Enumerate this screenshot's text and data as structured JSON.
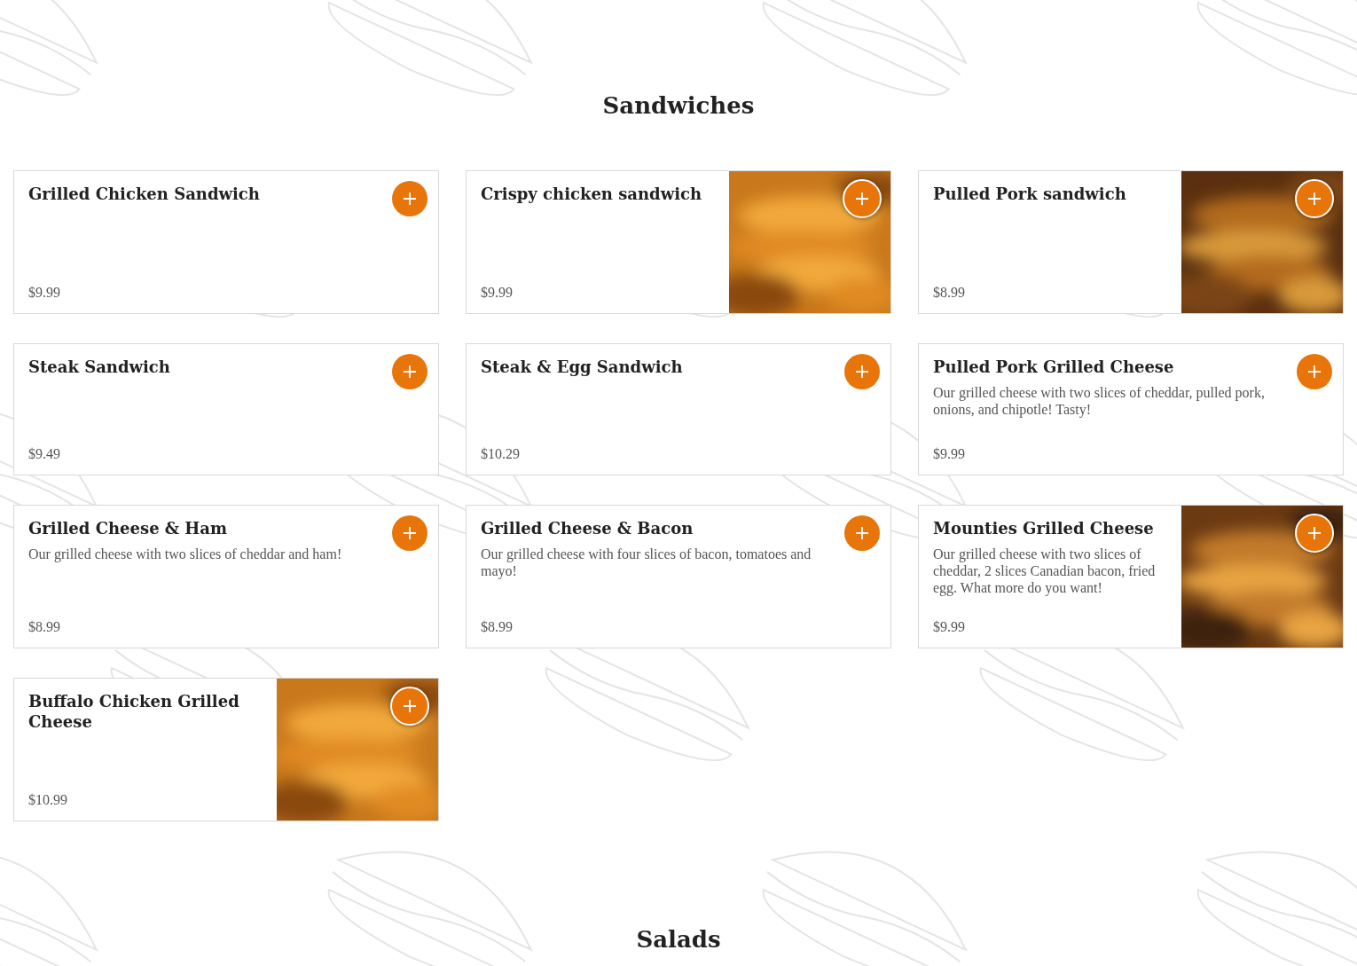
{
  "sections": [
    {
      "title": "Sandwiches",
      "items": [
        {
          "name": "Grilled Chicken Sandwich",
          "price": "$9.99",
          "kind": "plain"
        },
        {
          "name": "Crispy chicken sandwich",
          "price": "$9.99"
        },
        {
          "name": "Pulled Pork sandwich",
          "price": "$8.99"
        },
        {
          "name": "Steak Sandwich",
          "price": "$9.49",
          "kind": "plain"
        },
        {
          "name": "Steak & Egg Sandwich",
          "price": "$10.29",
          "kind": "plain"
        },
        {
          "name": "Pulled Pork Grilled Cheese",
          "description": "Our grilled cheese with two slices of cheddar, pulled pork, onions, and chipotle! Tasty!",
          "price": "$9.99",
          "kind": "plain"
        },
        {
          "name": "Grilled Cheese & Ham",
          "description": "Our grilled cheese with two slices of cheddar and ham!",
          "price": "$8.99",
          "kind": "plain"
        },
        {
          "name": "Grilled Cheese & Bacon",
          "description": "Our grilled cheese with four slices of bacon, tomatoes and mayo!",
          "price": "$8.99",
          "kind": "plain"
        },
        {
          "name": "Mounties Grilled Cheese",
          "description": "Our grilled cheese with two slices of cheddar, 2 slices Canadian bacon, fried egg. What more do you want!",
          "price": "$9.99"
        },
        {
          "name": "Buffalo Chicken Grilled Cheese",
          "price": "$10.99"
        }
      ]
    },
    {
      "title": "Salads"
    }
  ]
}
